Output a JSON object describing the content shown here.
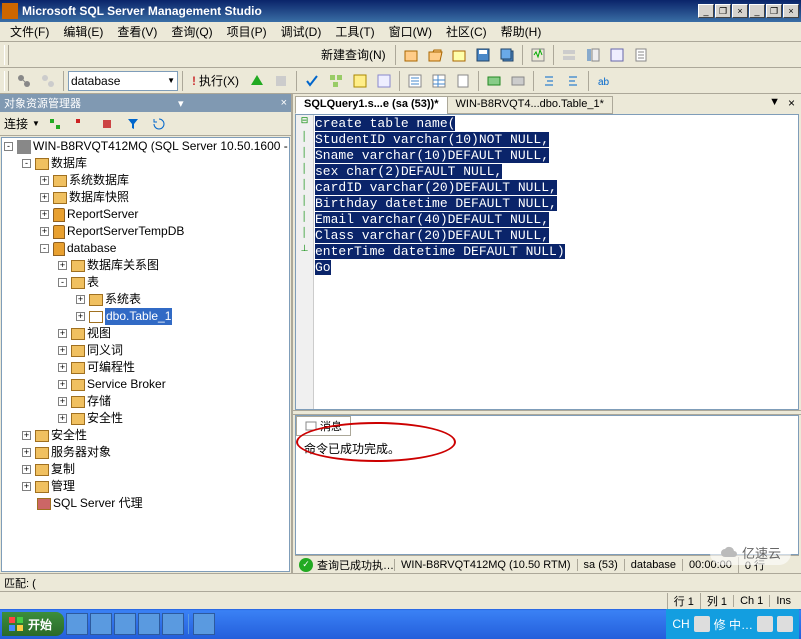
{
  "window": {
    "title": "Microsoft SQL Server Management Studio"
  },
  "menu": [
    "文件(F)",
    "编辑(E)",
    "查看(V)",
    "查询(Q)",
    "项目(P)",
    "调试(D)",
    "工具(T)",
    "窗口(W)",
    "社区(C)",
    "帮助(H)"
  ],
  "toolbar1": {
    "newquery": "新建查询(N)"
  },
  "toolbar2": {
    "combo": "database",
    "execute": "执行(X)"
  },
  "panel": {
    "title": "对象资源管理器",
    "connect": "连接",
    "root": "WIN-B8RVQT412MQ (SQL Server 10.50.1600 -",
    "databases": "数据库",
    "sysdb": "系统数据库",
    "snapshot": "数据库快照",
    "rs": "ReportServer",
    "rst": "ReportServerTempDB",
    "db": "database",
    "diagram": "数据库关系图",
    "tables": "表",
    "systables": "系统表",
    "table1": "dbo.Table_1",
    "views": "视图",
    "synonyms": "同义词",
    "prog": "可编程性",
    "sb": "Service Broker",
    "storage": "存储",
    "security": "安全性",
    "security2": "安全性",
    "srvobj": "服务器对象",
    "replication": "复制",
    "management": "管理",
    "agent": "SQL Server 代理"
  },
  "tabs": {
    "t1": "SQLQuery1.s...e (sa (53))*",
    "t2": "WIN-B8RVQT4...dbo.Table_1*"
  },
  "sql": [
    "create table name(",
    "StudentID varchar(10)NOT NULL,",
    "Sname varchar(10)DEFAULT NULL,",
    "sex char(2)DEFAULT NULL,",
    "cardID varchar(20)DEFAULT NULL,",
    "Birthday datetime DEFAULT NULL,",
    "Email varchar(40)DEFAULT NULL,",
    "Class varchar(20)DEFAULT NULL,",
    "enterTime datetime DEFAULT NULL)",
    "Go"
  ],
  "msg": {
    "tab": "消息",
    "text": "命令已成功完成。"
  },
  "status2": {
    "exec": "查询已成功执…",
    "server": "WIN-B8RVQT412MQ (10.50 RTM)",
    "user": "sa (53)",
    "db": "database",
    "time": "00:00:00",
    "rows": "0 行"
  },
  "matchbar": {
    "label": "匹配: ("
  },
  "status": {
    "row": "行 1",
    "col": "列 1",
    "ch": "Ch 1",
    "ins": "Ins"
  },
  "taskbar": {
    "start": "开始",
    "ch": "CH",
    "loading": "修   中…"
  },
  "watermark": "亿速云"
}
